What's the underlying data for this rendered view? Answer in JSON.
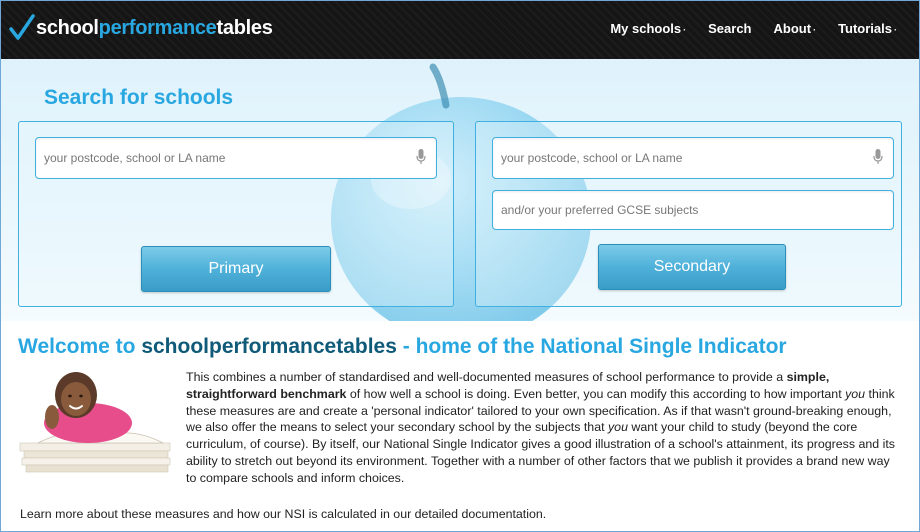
{
  "brand": {
    "part1": "school",
    "part2": "performance",
    "part3": "tables"
  },
  "nav": {
    "items": [
      {
        "label": "My schools",
        "dropdown": true
      },
      {
        "label": "Search",
        "dropdown": false
      },
      {
        "label": "About",
        "dropdown": true
      },
      {
        "label": "Tutorials",
        "dropdown": true
      }
    ],
    "dropdown_glyph": "·"
  },
  "search": {
    "title": "Search for schools",
    "primary": {
      "placeholder": "your postcode, school or LA name",
      "button": "Primary"
    },
    "secondary": {
      "placeholder": "your postcode, school or LA name",
      "subjects_placeholder": "and/or your preferred GCSE subjects",
      "button": "Secondary"
    }
  },
  "welcome": {
    "prefix": "Welcome to ",
    "site": "schoolperformancetables",
    "suffix": " - home of the National Single Indicator"
  },
  "intro": {
    "t1": "This combines a number of standardised and well-documented measures of school performance to provide a ",
    "b1": "simple, straightforward benchmark",
    "t2": " of how well a school is doing. Even better, you can modify this according to how important ",
    "i1": "you",
    "t3": " think these measures are and create a 'personal indicator' tailored to your own specification. As if that wasn't ground-breaking enough, we also offer the means to select your secondary school by the subjects that ",
    "i2": "you",
    "t4": " want your child to study (beyond the core curriculum, of course). By itself, our National Single Indicator gives a good illustration of a school's attainment, its progress and its ability to stretch out beyond its environment. Together with a number of other factors that we publish it provides a brand new way to compare schools and inform choices."
  },
  "learn_more": "Learn more about these measures and how our NSI is calculated in our detailed documentation.",
  "colors": {
    "accent": "#29a7e1",
    "dark_accent": "#0f5a78",
    "nav_bg": "#151515"
  }
}
